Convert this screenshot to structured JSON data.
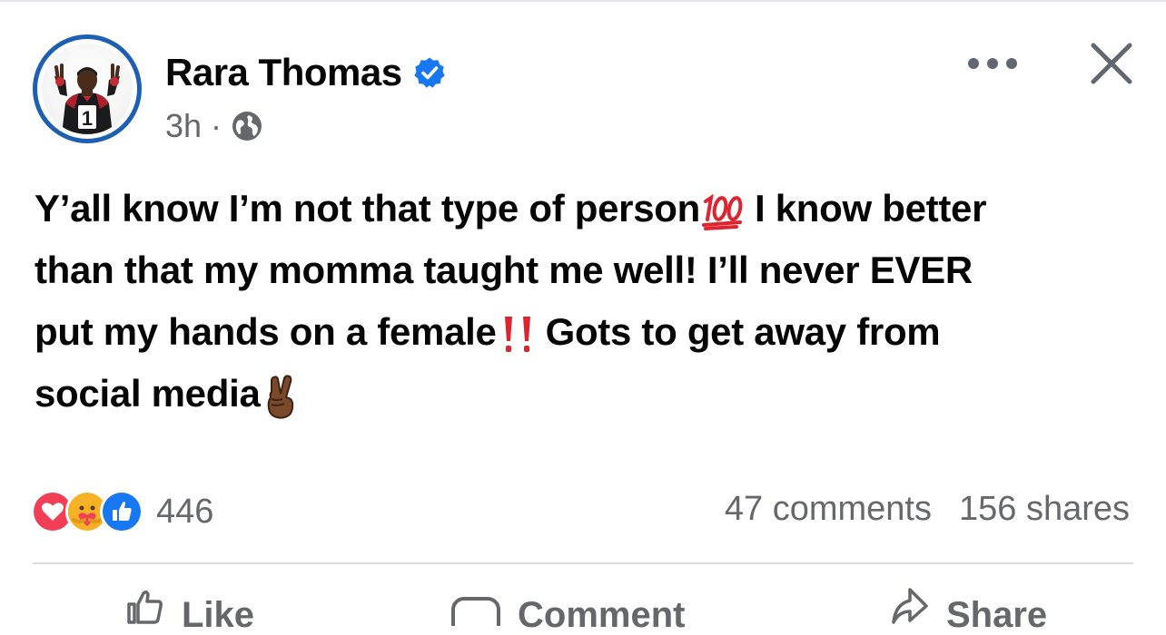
{
  "post": {
    "author": "Rara Thomas",
    "time": "3h",
    "separator": "·",
    "lines": [
      [
        "Y’all know I’m not that type of person",
        "💯",
        "I know better"
      ],
      [
        "than that my momma taught me well! I’ll never EVER"
      ],
      [
        "put my hands on a female",
        "‼️",
        "Gots to get away from"
      ],
      [
        "social media",
        "✌🏾"
      ]
    ],
    "line_parts": {
      "l1a": "Y’all know I’m not that type of person",
      "l1b": "I know better",
      "l2": "than that my momma taught me well! I’ll never EVER",
      "l3a": "put my hands on a female",
      "l3b": "Gots to get away from",
      "l4": "social media"
    }
  },
  "engagement": {
    "reaction_count": "446",
    "comments": "47 comments",
    "shares": "156 shares",
    "reaction_icons": [
      "love-icon",
      "care-icon",
      "like-icon"
    ]
  },
  "actions": {
    "like": "Like",
    "comment": "Comment",
    "share": "Share"
  },
  "colors": {
    "accent": "#1877f2",
    "ring": "#1d5fb3",
    "muted": "#65676b",
    "love": "#f33e58",
    "emoji_red": "#e0242f"
  }
}
